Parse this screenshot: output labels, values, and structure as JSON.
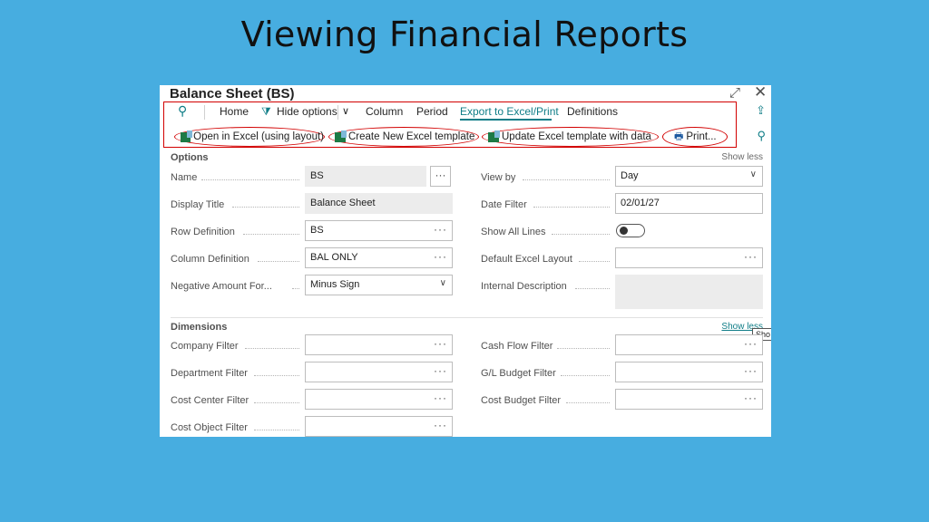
{
  "slide_title": "Viewing Financial Reports",
  "window": {
    "title": "Balance Sheet (BS)",
    "expand_icon": "expand-icon",
    "close_icon": "close-icon"
  },
  "menu": {
    "search_icon": "search-icon",
    "home": "Home",
    "hide_options": "Hide options",
    "column": "Column",
    "period": "Period",
    "export": "Export to Excel/Print",
    "definitions": "Definitions"
  },
  "actions": {
    "open_excel": "Open in Excel (using layout)",
    "create_template": "Create New Excel template",
    "update_template": "Update Excel template with data",
    "print": "Print..."
  },
  "options": {
    "title": "Options",
    "show_less": "Show less",
    "name_label": "Name",
    "name_value": "BS",
    "display_title_label": "Display Title",
    "display_title_value": "Balance Sheet",
    "row_def_label": "Row Definition",
    "row_def_value": "BS",
    "col_def_label": "Column Definition",
    "col_def_value": "BAL ONLY",
    "neg_amount_label": "Negative Amount For...",
    "neg_amount_value": "Minus Sign",
    "view_by_label": "View by",
    "view_by_value": "Day",
    "date_filter_label": "Date Filter",
    "date_filter_value": "02/01/27",
    "show_all_lines_label": "Show All Lines",
    "show_all_lines_on": false,
    "default_excel_label": "Default Excel Layout",
    "default_excel_value": "",
    "internal_desc_label": "Internal Description",
    "internal_desc_value": ""
  },
  "dimensions": {
    "title": "Dimensions",
    "show_less": "Show less",
    "tooltip": "Sho",
    "company_filter": "Company Filter",
    "department_filter": "Department Filter",
    "cost_center_filter": "Cost Center Filter",
    "cost_object_filter": "Cost Object Filter",
    "cash_flow_filter": "Cash Flow Filter",
    "gl_budget_filter": "G/L Budget Filter",
    "cost_budget_filter": "Cost Budget Filter"
  },
  "colors": {
    "background": "#47ade0",
    "accent": "#0f7d87",
    "highlight": "#d20000"
  }
}
